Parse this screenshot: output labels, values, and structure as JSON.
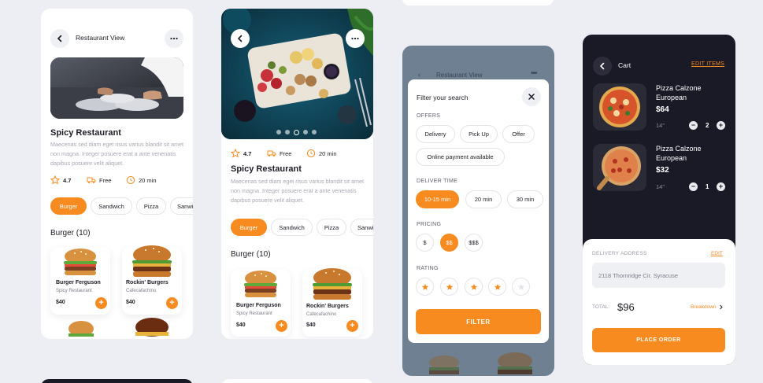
{
  "screen1": {
    "header_title": "Restaurant View",
    "restaurant_name": "Spicy Restaurant",
    "description": "Maecenas sed diam eget risus varius blandit sit amet non magna. Integer posuere erat a ante venenatis dapibus posuere velit aliquet.",
    "rating": "4.7",
    "delivery": "Free",
    "time": "20 min",
    "categories": [
      "Burger",
      "Sandwich",
      "Pizza",
      "Sanwi"
    ],
    "section_title": "Burger (10)",
    "items": [
      {
        "name": "Burger Ferguson",
        "sub": "Spicy Restaurant",
        "price": "$40"
      },
      {
        "name": "Rockin' Burgers",
        "sub": "Cafecafachino",
        "price": "$40"
      }
    ]
  },
  "screen2": {
    "rating": "4.7",
    "delivery": "Free",
    "time": "20 min",
    "restaurant_name": "Spicy Restaurant",
    "description": "Maecenas sed diam eget risus varius blandit sit amet non magna. Integer posuere erat a ante venenatis dapibus posuere velit aliquet.",
    "categories": [
      "Burger",
      "Sandwich",
      "Pizza",
      "Sanwi"
    ],
    "section_title": "Burger (10)",
    "items": [
      {
        "name": "Burger Ferguson",
        "sub": "Spicy Restaurant",
        "price": "$40"
      },
      {
        "name": "Rockin' Burgers",
        "sub": "Cafecafachino",
        "price": "$40"
      }
    ]
  },
  "screen3": {
    "back_title": "Restaurant View",
    "modal_title": "Filter your search",
    "offers_label": "OFFERS",
    "offers": [
      "Delivery",
      "Pick Up",
      "Offer",
      "Online payment available"
    ],
    "deliver_time_label": "DELIVER TIME",
    "deliver_times": [
      "10-15 min",
      "20 min",
      "30 min"
    ],
    "pricing_label": "PRICING",
    "pricing": [
      "$",
      "$$",
      "$$$"
    ],
    "rating_label": "RATING",
    "filter_button": "FILTER"
  },
  "screen4": {
    "title": "Cart",
    "edit_items": "EDIT ITEMS",
    "items": [
      {
        "name": "Pizza Calzone European",
        "price": "$64",
        "size": "14\"",
        "qty": "2"
      },
      {
        "name": "Pizza Calzone European",
        "price": "$32",
        "size": "14\"",
        "qty": "1"
      }
    ],
    "delivery_label": "DELIVERY ADDRESS",
    "edit": "EDIT",
    "address": "2118 Thornridge Cir. Syracuse",
    "total_label": "TOTAL:",
    "total": "$96",
    "breakdown": "Breakdown",
    "place_order": "PLACE ORDER"
  },
  "colors": {
    "accent": "#f78b1f",
    "dark": "#1a1a27",
    "background": "#eceef3"
  }
}
